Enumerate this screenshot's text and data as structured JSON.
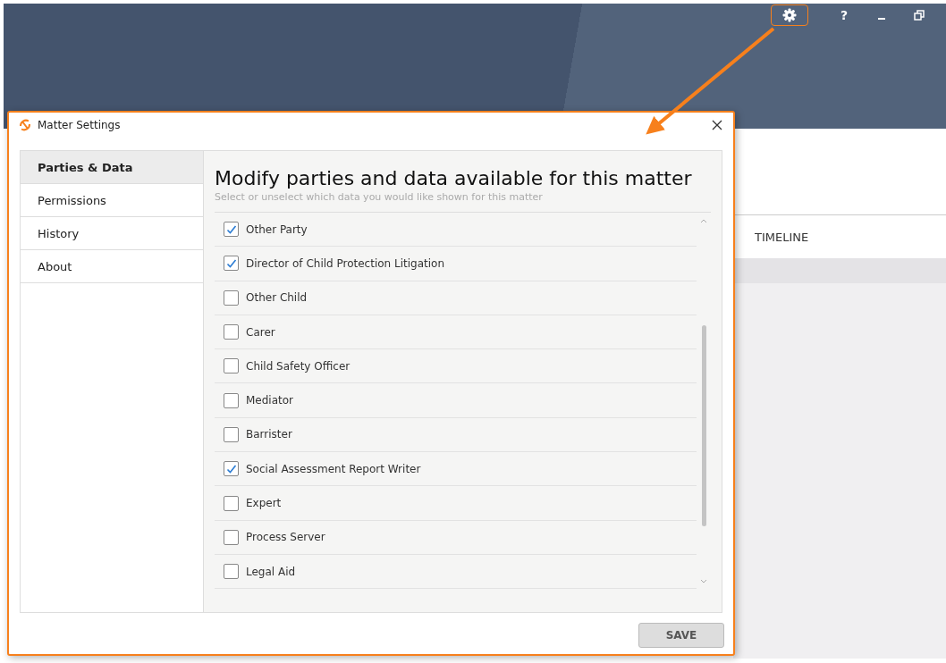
{
  "app": {
    "help_label": "?",
    "tab": "TIMELINE"
  },
  "dialog": {
    "title": "Matter Settings",
    "heading": "Modify parties and data available for this matter",
    "subheading": "Select or unselect which data you would like shown for this matter",
    "nav": [
      {
        "label": "Parties & Data",
        "selected": true
      },
      {
        "label": "Permissions",
        "selected": false
      },
      {
        "label": "History",
        "selected": false
      },
      {
        "label": "About",
        "selected": false
      }
    ],
    "items": [
      {
        "label": "Other Party",
        "checked": true
      },
      {
        "label": "Director of Child Protection Litigation",
        "checked": true
      },
      {
        "label": "Other Child",
        "checked": false
      },
      {
        "label": "Carer",
        "checked": false
      },
      {
        "label": "Child Safety Officer",
        "checked": false
      },
      {
        "label": "Mediator",
        "checked": false
      },
      {
        "label": "Barrister",
        "checked": false
      },
      {
        "label": "Social Assessment Report Writer",
        "checked": true
      },
      {
        "label": "Expert",
        "checked": false
      },
      {
        "label": "Process Server",
        "checked": false
      },
      {
        "label": "Legal Aid",
        "checked": false
      }
    ],
    "save_button": "SAVE"
  }
}
